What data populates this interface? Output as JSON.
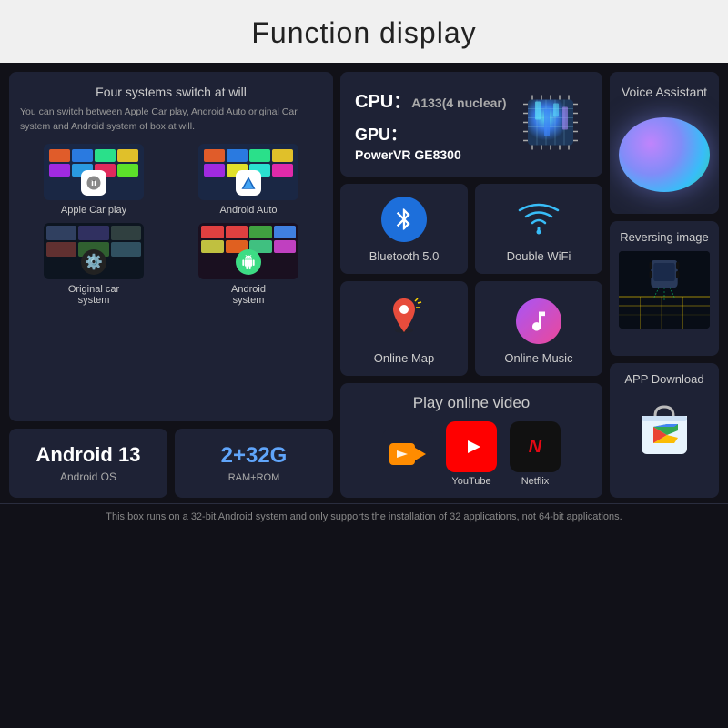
{
  "page": {
    "title": "Function display",
    "background": "#111118"
  },
  "col1": {
    "four_systems": {
      "title": "Four systems switch at will",
      "description": "You can switch between Apple Car play, Android Auto original Car system and Android system of box at will.",
      "systems": [
        {
          "name": "Apple Car play",
          "icon": "carplay"
        },
        {
          "name": "Android Auto",
          "icon": "android-auto"
        },
        {
          "name": "Original car system",
          "icon": "car-system"
        },
        {
          "name": "Android system",
          "icon": "android-system"
        }
      ]
    },
    "android_os": {
      "number": "Android 13",
      "label": "Android OS"
    },
    "ram_rom": {
      "value": "2+32G",
      "label": "RAM+ROM"
    }
  },
  "col2": {
    "cpu": {
      "label": "CPU：",
      "model": "A133(4 nuclear)",
      "gpu_label": "GPU：",
      "gpu_model": "PowerVR GE8300"
    },
    "bluetooth": {
      "label": "Bluetooth 5.0"
    },
    "wifi": {
      "label": "Double WiFi"
    },
    "play_video": {
      "title": "Play online video",
      "apps": [
        {
          "name": "video-player",
          "label": ""
        },
        {
          "name": "YouTube",
          "label": "YouTube"
        },
        {
          "name": "Netflix",
          "label": "Netflix"
        }
      ]
    },
    "online_map": {
      "label": "Online Map"
    },
    "online_music": {
      "label": "Online Music"
    }
  },
  "col3": {
    "voice_assistant": {
      "title": "Voice Assistant"
    },
    "reversing_image": {
      "title": "Reversing image"
    },
    "app_download": {
      "title": "APP Download"
    }
  },
  "footer": {
    "note": "This box runs on a 32-bit Android system and only supports the installation of 32 applications, not 64-bit applications."
  }
}
